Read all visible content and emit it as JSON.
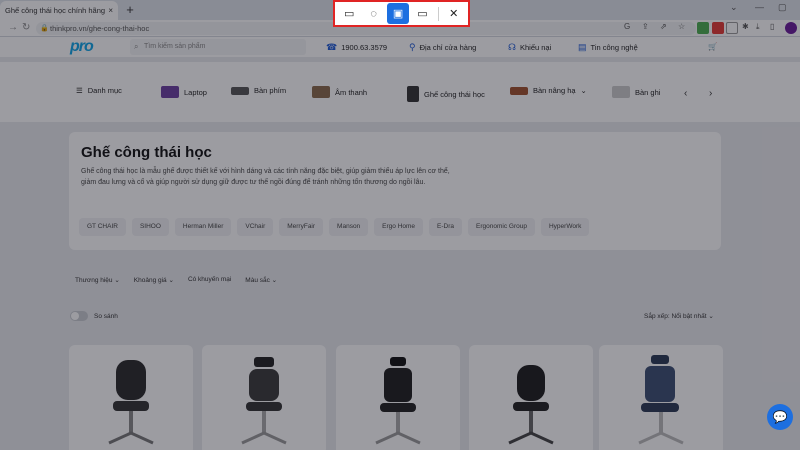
{
  "browser": {
    "tab_title": "Ghế công thái học chính hãng ...",
    "tab_close": "×",
    "new_tab": "+",
    "url": "thinkpro.vn/ghe-cong-thai-hoc",
    "window_controls": [
      "⌄",
      "—",
      "▢"
    ]
  },
  "snipping_tool": {
    "modes": [
      {
        "name": "rectangle-snip-icon",
        "glyph": "▭"
      },
      {
        "name": "freeform-snip-icon",
        "glyph": "◌"
      },
      {
        "name": "window-snip-icon",
        "glyph": "▣"
      },
      {
        "name": "fullscreen-snip-icon",
        "glyph": "▭"
      }
    ],
    "close": "✕"
  },
  "header": {
    "logo": "pro",
    "search_placeholder": "Tìm kiếm sản phẩm",
    "hotline": "1900.63.3579",
    "store_locator": "Địa chỉ cửa hàng",
    "complaints": "Khiếu nại",
    "tech_news": "Tin công nghệ",
    "cart_icon": "cart-icon"
  },
  "categories": {
    "menu_label": "Danh mục",
    "items": [
      "Laptop",
      "Bàn phím",
      "Âm thanh",
      "Ghế công thái học",
      "Bàn nâng hạ",
      "Bàn ghi"
    ]
  },
  "intro": {
    "title": "Ghế công thái học",
    "description": "Ghế công thái học là mẫu ghế được thiết kế với hình dáng và các tính năng đặc biệt, giúp giảm thiểu áp lực lên cơ thể, giảm đau lưng và cổ và giúp người sử dụng giữ được tư thế ngồi đúng để tránh những tổn thương do ngồi lâu.",
    "brands": [
      "GT CHAIR",
      "SIHOO",
      "Herman Miller",
      "VChair",
      "MerryFair",
      "Manson",
      "Ergo Home",
      "E-Dra",
      "Ergonomic Group",
      "HyperWork"
    ]
  },
  "filters": {
    "items": [
      "Thương hiệu ⌄",
      "Khoảng giá ⌄",
      "Có khuyến mại",
      "Màu sắc ⌄"
    ],
    "compare_label": "So sánh",
    "sort_label": "Sắp xếp: Nổi bật nhất ⌄"
  },
  "colors": {
    "accent": "#1d6fe0",
    "snip_border": "#e02424",
    "logo": "#0ea5e9"
  }
}
